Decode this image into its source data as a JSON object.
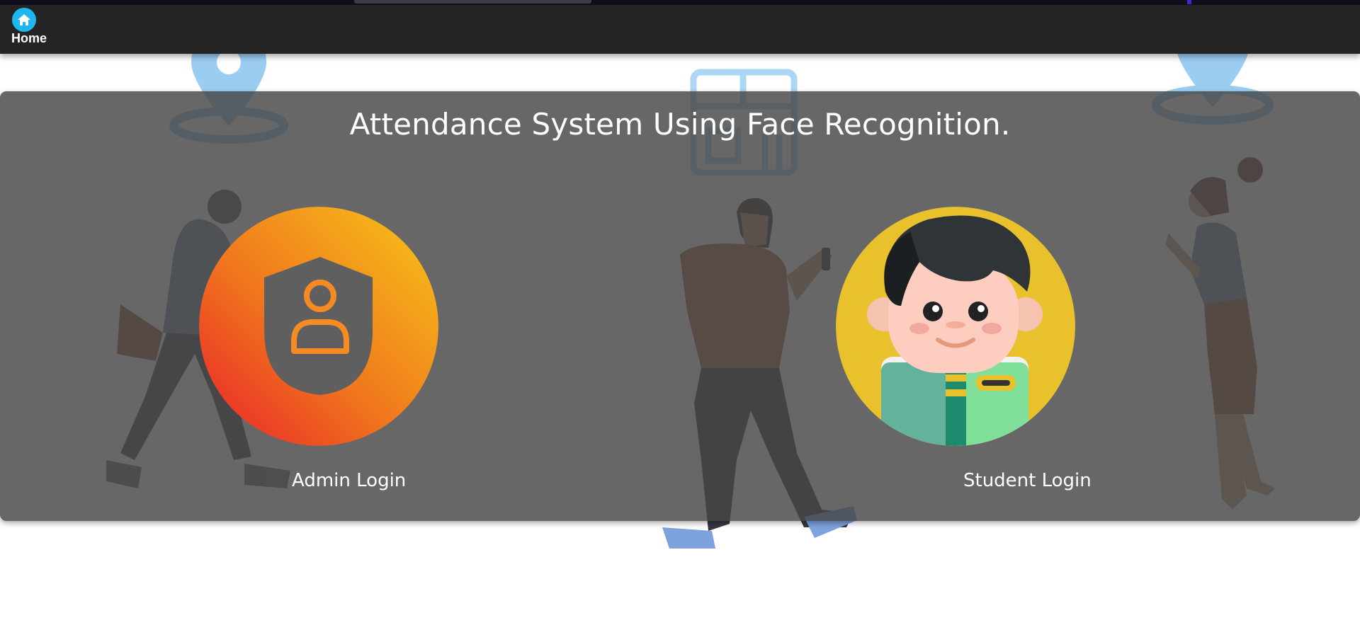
{
  "nav": {
    "home_label": "Home",
    "home_icon": "home-icon",
    "accent": "#1eb6ef"
  },
  "main": {
    "title": "Attendance System Using Face Recognition.",
    "logins": [
      {
        "label": "Admin Login",
        "icon": "admin-shield-user-icon",
        "gradient": [
          "#f7c619",
          "#e8202a"
        ]
      },
      {
        "label": "Student Login",
        "icon": "student-avatar-icon",
        "background": "#e9c12d"
      }
    ]
  },
  "background": {
    "illustration": "people-walking-with-phones",
    "colors": {
      "pin": "#4aa5ea",
      "panel": "#464646"
    }
  }
}
